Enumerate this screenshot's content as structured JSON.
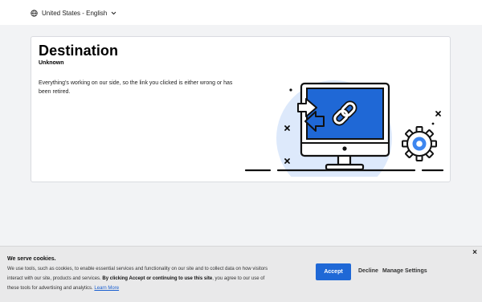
{
  "header": {
    "locale_label": "United States - English",
    "icons": {
      "globe": "globe-icon",
      "chevron": "chevron-down-icon"
    }
  },
  "error_card": {
    "title": "Destination",
    "subtitle": "Unknown",
    "message": "Everything's working on our side, so the link you clicked is either wrong or has been retired.",
    "illustration": "broken-link-monitor-illustration"
  },
  "cookie_banner": {
    "title": "We serve cookies.",
    "body_part1": "We use tools, such as cookies, to enable essential services and functionality on our site and to collect data on how visitors interact with our site, products and services. ",
    "body_bold": "By clicking Accept or continuing to use this site",
    "body_part2": ", you agree to our use of these tools for advertising and analytics. ",
    "learn_more": "Learn More",
    "accept_label": "Accept",
    "decline_label": "Decline",
    "manage_label": "Manage Settings",
    "close_glyph": "×"
  },
  "colors": {
    "accent": "#1f68d6",
    "page_background": "#f2f3f5",
    "illustration_blue": "#1f68d6",
    "illustration_light": "#dde9fb"
  }
}
